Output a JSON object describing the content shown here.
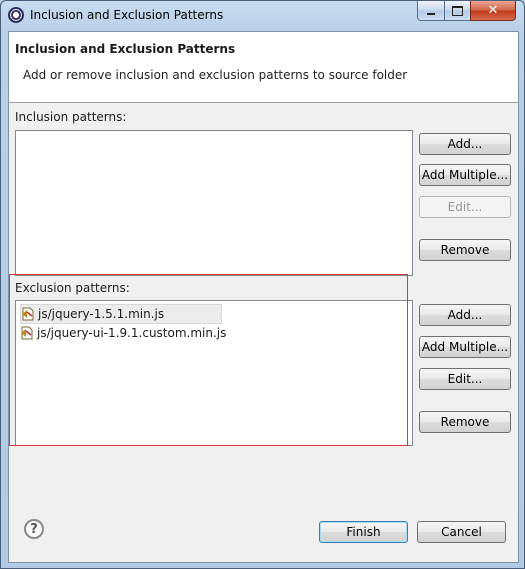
{
  "window": {
    "title": "Inclusion and Exclusion Patterns",
    "minimize_label": "minimize",
    "maximize_label": "maximize",
    "close_label": "close"
  },
  "header": {
    "title": "Inclusion and Exclusion Patterns",
    "description": "Add or remove inclusion and exclusion patterns to source folder"
  },
  "inclusion": {
    "label": "Inclusion patterns:",
    "items": [],
    "buttons": {
      "add": "Add...",
      "add_multiple": "Add Multiple...",
      "edit": "Edit...",
      "remove": "Remove"
    }
  },
  "exclusion": {
    "label": "Exclusion patterns:",
    "items": [
      {
        "text": "js/jquery-1.5.1.min.js",
        "selected": true,
        "icon": "exclusion-filter-icon"
      },
      {
        "text": "js/jquery-ui-1.9.1.custom.min.js",
        "selected": false,
        "icon": "exclusion-filter-icon"
      }
    ],
    "buttons": {
      "add": "Add...",
      "add_multiple": "Add Multiple...",
      "edit": "Edit...",
      "remove": "Remove"
    }
  },
  "footer": {
    "help_icon": "help-icon",
    "finish": "Finish",
    "cancel": "Cancel"
  },
  "colors": {
    "highlight_border": "#d63a3a",
    "close_button": "#c13a1c"
  }
}
